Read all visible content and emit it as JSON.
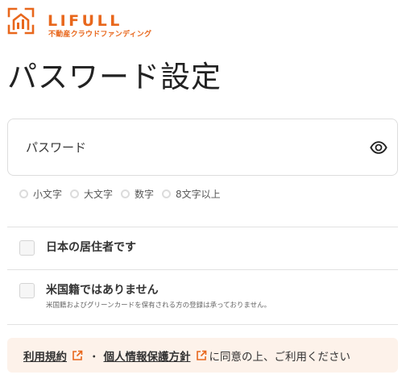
{
  "brand": {
    "name": "LIFULL",
    "subtitle": "不動産クラウドファンディング",
    "color": "#e8671c"
  },
  "page": {
    "title": "パスワード設定"
  },
  "password_field": {
    "placeholder": "パスワード",
    "value": "",
    "toggle_icon": "eye-icon"
  },
  "password_rules": [
    {
      "label": "小文字",
      "satisfied": false
    },
    {
      "label": "大文字",
      "satisfied": false
    },
    {
      "label": "数字",
      "satisfied": false
    },
    {
      "label": "8文字以上",
      "satisfied": false
    }
  ],
  "checkboxes": [
    {
      "label": "日本の居住者です",
      "checked": false
    },
    {
      "label": "米国籍ではありません",
      "note": "米国籍およびグリーンカードを保有される方の登録は承っておりません。",
      "checked": false
    }
  ],
  "agreement": {
    "terms_link": "利用規約",
    "separator": "・",
    "privacy_link": "個人情報保護方針",
    "suffix": "に同意の上、ご利用ください",
    "background": "#fdf2ea"
  }
}
